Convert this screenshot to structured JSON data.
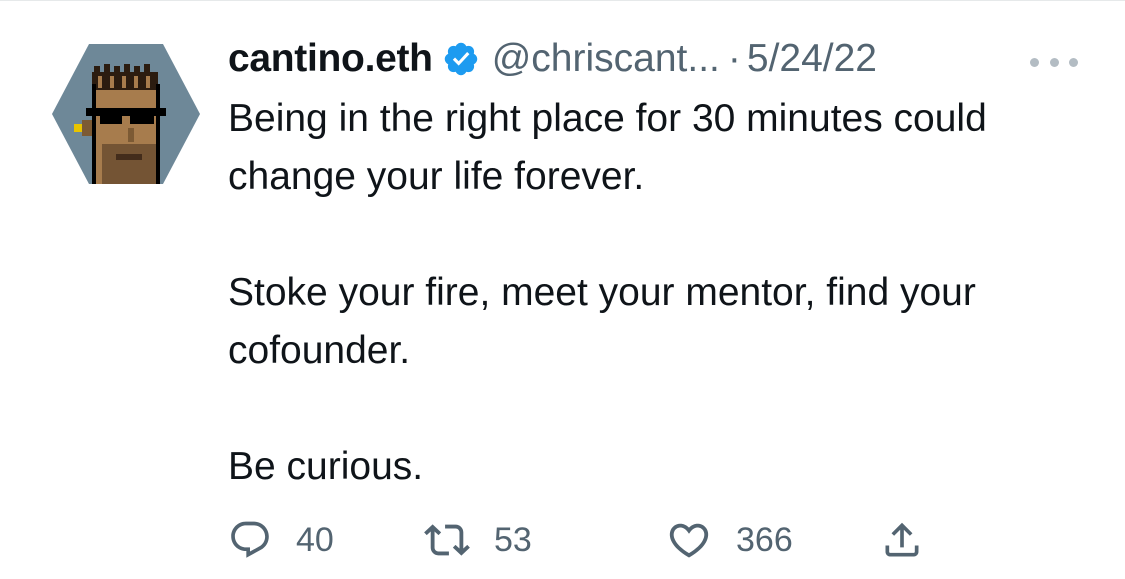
{
  "tweet": {
    "author": {
      "display_name": "cantino.eth",
      "handle": "@chriscant...",
      "verified": true,
      "avatar_icon": "pixel-punk-avatar-icon"
    },
    "separator": "·",
    "date": "5/24/22",
    "body": [
      "Being in the right place for 30 minutes could change your life forever.",
      "Stoke your fire, meet your mentor, find your cofounder.",
      "Be curious."
    ],
    "stats": {
      "replies": "40",
      "retweets": "53",
      "likes": "366"
    }
  },
  "colors": {
    "text_primary": "#0f1419",
    "text_secondary": "#536471",
    "verified_blue": "#1d9bf0",
    "avatar_bg": "#6e8898"
  }
}
